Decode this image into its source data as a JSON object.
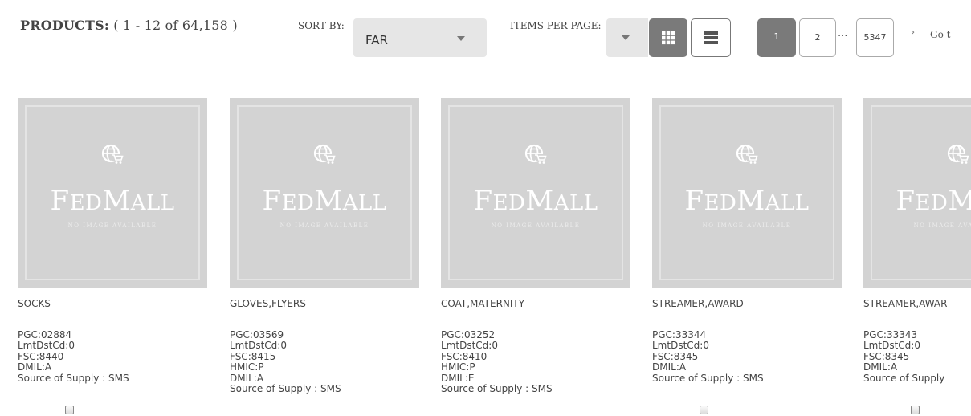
{
  "toolbar": {
    "products_label": "PRODUCTS:",
    "products_range": "( 1 - 12 of 64,158 )",
    "sort_label": "SORT BY:",
    "sort_value": "FAR",
    "items_per_page_label": "ITEMS PER PAGE:",
    "items_per_page_value": "",
    "view_grid_icon": "grid-view-icon",
    "view_list_icon": "list-view-icon"
  },
  "pagination": {
    "current": "1",
    "page2": "2",
    "ellipsis": "...",
    "last": "5347",
    "next": "›",
    "goto": "Go t"
  },
  "placeholder": {
    "brand_big_1": "F",
    "brand_small_1": "ED",
    "brand_big_2": "M",
    "brand_small_2": "ALL",
    "subtitle": "NO IMAGE AVAILABLE",
    "icon": "globe-cart-icon"
  },
  "products": [
    {
      "name": "SOCKS",
      "attrs": [
        "PGC:02884",
        "LmtDstCd:0",
        "FSC:8440",
        "DMIL:A",
        "Source of Supply : SMS"
      ]
    },
    {
      "name": "GLOVES,FLYERS",
      "attrs": [
        "PGC:03569",
        "LmtDstCd:0",
        "FSC:8415",
        "HMIC:P",
        "DMIL:A",
        "Source of Supply : SMS"
      ]
    },
    {
      "name": "COAT,MATERNITY",
      "attrs": [
        "PGC:03252",
        "LmtDstCd:0",
        "FSC:8410",
        "HMIC:P",
        "DMIL:E",
        "Source of Supply : SMS"
      ]
    },
    {
      "name": "STREAMER,AWARD",
      "attrs": [
        "PGC:33344",
        "LmtDstCd:0",
        "FSC:8345",
        "DMIL:A",
        "Source of Supply : SMS"
      ]
    },
    {
      "name": "STREAMER,AWAR",
      "attrs": [
        "PGC:33343",
        "LmtDstCd:0",
        "FSC:8345",
        "DMIL:A",
        "Source of Supply"
      ]
    }
  ],
  "colors": {
    "accent_gray": "#7a7a7a",
    "select_bg": "#e6e6e6",
    "thumb_bg": "#d3d3d3"
  }
}
